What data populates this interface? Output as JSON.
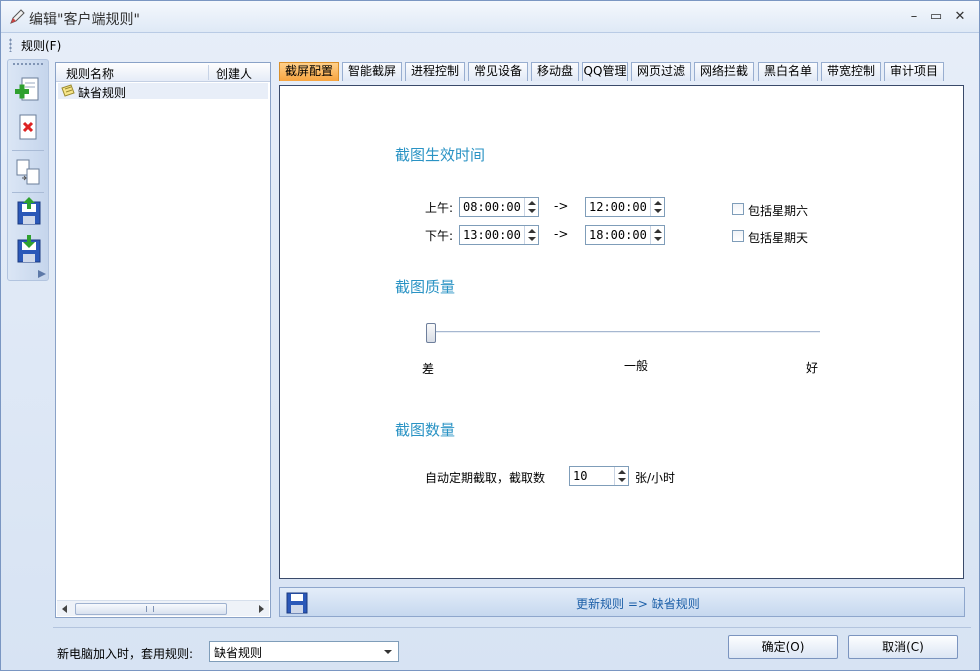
{
  "window": {
    "title": "编辑\"客户端规则\""
  },
  "menu": {
    "rules": "规则(F)"
  },
  "rule_list": {
    "columns": [
      "规则名称",
      "创建人"
    ],
    "rows": [
      {
        "name": "缺省规则",
        "creator": ""
      }
    ]
  },
  "tabs": [
    "截屏配置",
    "智能截屏",
    "进程控制",
    "常见设备",
    "移动盘",
    "QQ管理",
    "网页过滤",
    "网络拦截",
    "黑白名单",
    "带宽控制",
    "审计项目"
  ],
  "active_tab": "截屏配置",
  "screenshot_config": {
    "time_title": "截图生效时间",
    "am_label": "上午:",
    "pm_label": "下午:",
    "arrow": "->",
    "am_start": "08:00:00",
    "am_end": "12:00:00",
    "pm_start": "13:00:00",
    "pm_end": "18:00:00",
    "include_saturday": "包括星期六",
    "include_sunday": "包括星期天",
    "quality_title": "截图质量",
    "quality_low": "差",
    "quality_mid": "一般",
    "quality_high": "好",
    "quality_level": 0,
    "count_title": "截图数量",
    "count_label": "自动定期截取，截取数",
    "count_value": "10",
    "count_unit": "张/小时"
  },
  "update_bar": {
    "text": "更新规则 => 缺省规则"
  },
  "footer": {
    "new_pc_label": "新电脑加入时，套用规则:",
    "selected_rule": "缺省规则",
    "ok": "确定(O)",
    "cancel": "取消(C)"
  }
}
